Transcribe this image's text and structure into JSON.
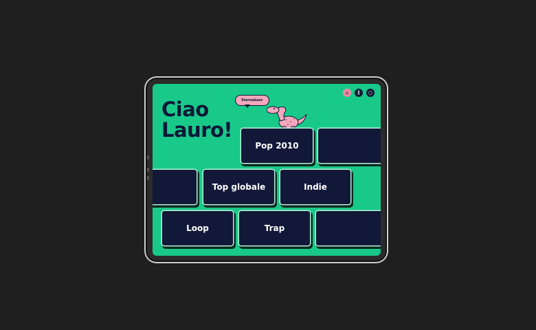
{
  "app": {
    "greeting_line1": "Ciao",
    "greeting_line2": "Lauro!",
    "bubble_text": "Sternakaur"
  },
  "header": {
    "icons": [
      "home-icon",
      "library-icon",
      "search-icon"
    ]
  },
  "tiles": [
    {
      "label": "Pop 2010"
    },
    {
      "label": ""
    },
    {
      "label": ""
    },
    {
      "label": "Top globale"
    },
    {
      "label": "Indie"
    },
    {
      "label": "Loop"
    },
    {
      "label": "Trap"
    },
    {
      "label": ""
    }
  ],
  "colors": {
    "background": "#1f1f1f",
    "screen": "#19c98a",
    "tile": "#121838",
    "text_dark": "#0b1836",
    "accent_pink": "#f4a7bd"
  }
}
